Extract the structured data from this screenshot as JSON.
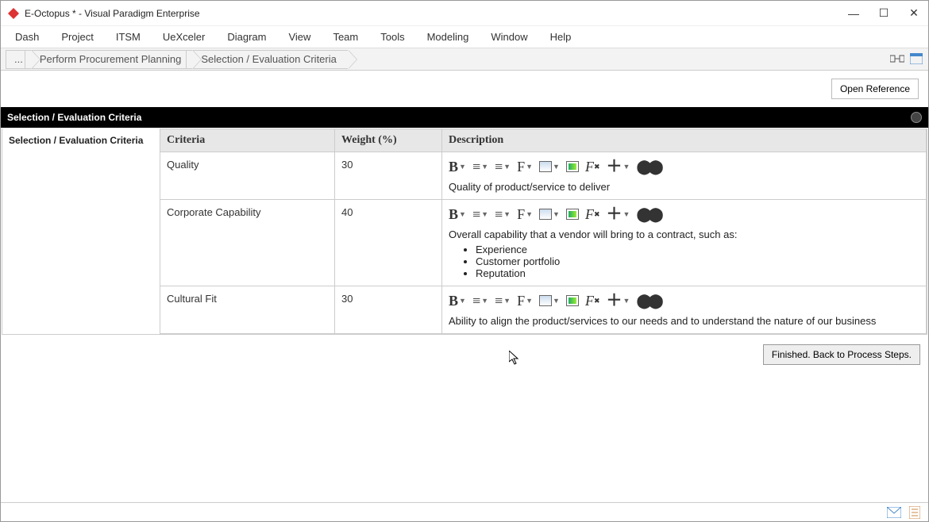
{
  "window": {
    "title": "E-Octopus * - Visual Paradigm Enterprise"
  },
  "menu": [
    "Dash",
    "Project",
    "ITSM",
    "UeXceler",
    "Diagram",
    "View",
    "Team",
    "Tools",
    "Modeling",
    "Window",
    "Help"
  ],
  "breadcrumbs": [
    "...",
    "Perform Procurement Planning",
    "Selection / Evaluation Criteria"
  ],
  "buttons": {
    "open_reference": "Open Reference",
    "finished": "Finished. Back to Process Steps."
  },
  "section_title": "Selection / Evaluation Criteria",
  "side_label": "Selection / Evaluation Criteria",
  "table": {
    "headers": [
      "Criteria",
      "Weight (%)",
      "Description"
    ],
    "rows": [
      {
        "criteria": "Quality",
        "weight": "30",
        "description": "Quality of product/service to deliver",
        "bullets": []
      },
      {
        "criteria": "Corporate Capability",
        "weight": "40",
        "description": "Overall capability that a vendor will bring to a contract, such as:",
        "bullets": [
          "Experience",
          "Customer portfolio",
          "Reputation"
        ]
      },
      {
        "criteria": "Cultural Fit",
        "weight": "30",
        "description": "Ability to align the product/services to our needs and to understand the nature of our business",
        "bullets": []
      }
    ]
  }
}
